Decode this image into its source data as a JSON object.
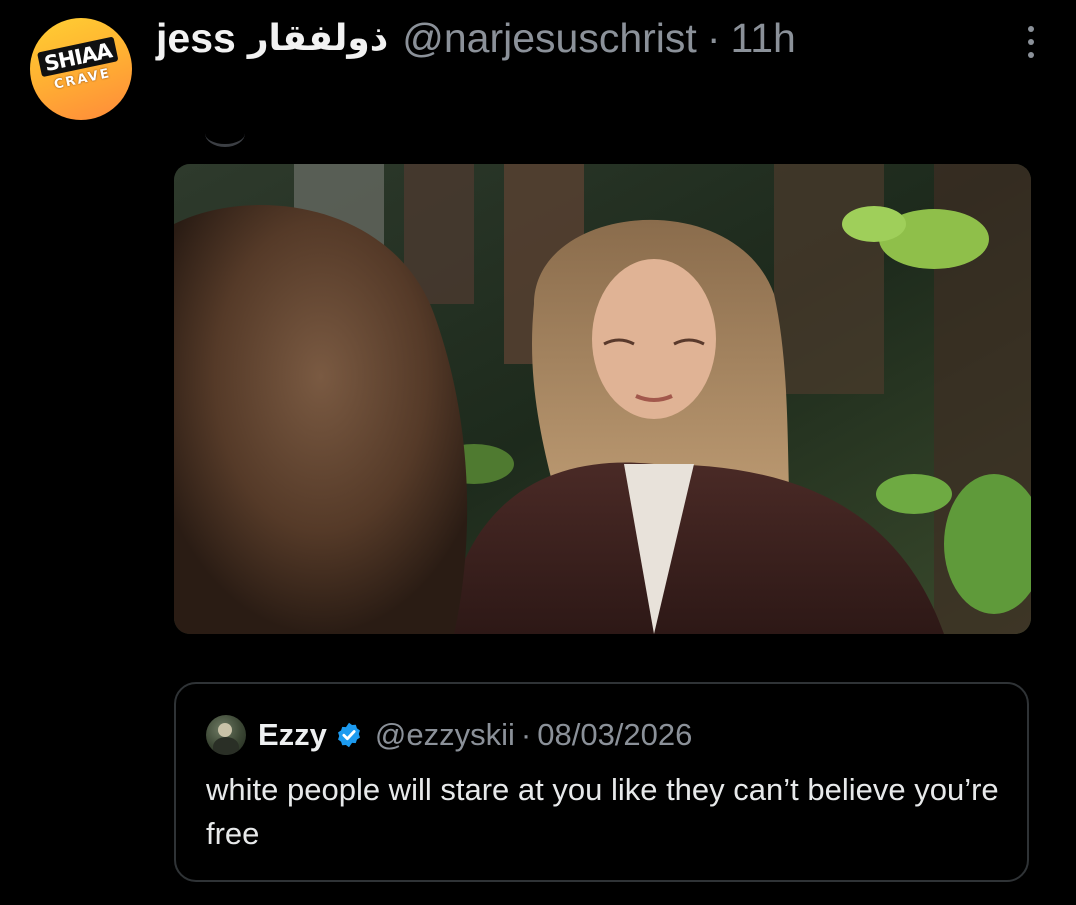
{
  "author": {
    "avatar_text_top": "SHIAA",
    "avatar_text_bottom": "CRAVE",
    "display_name": "jess",
    "display_name_arabic": "ذولفقار",
    "handle": "@narjesuschrist",
    "separator": "·",
    "time": "11h"
  },
  "colors": {
    "background": "#000000",
    "muted": "#8b9199",
    "verified": "#1d9bf0",
    "border": "#2f3336"
  },
  "icons": {
    "more": "more-vertical-icon",
    "verified": "verified-badge-icon"
  },
  "quote": {
    "display_name": "Ezzy",
    "handle": "@ezzyskii",
    "separator": "·",
    "date": "08/03/2026",
    "text": "white people will stare at you like they can’t believe you’re free"
  }
}
